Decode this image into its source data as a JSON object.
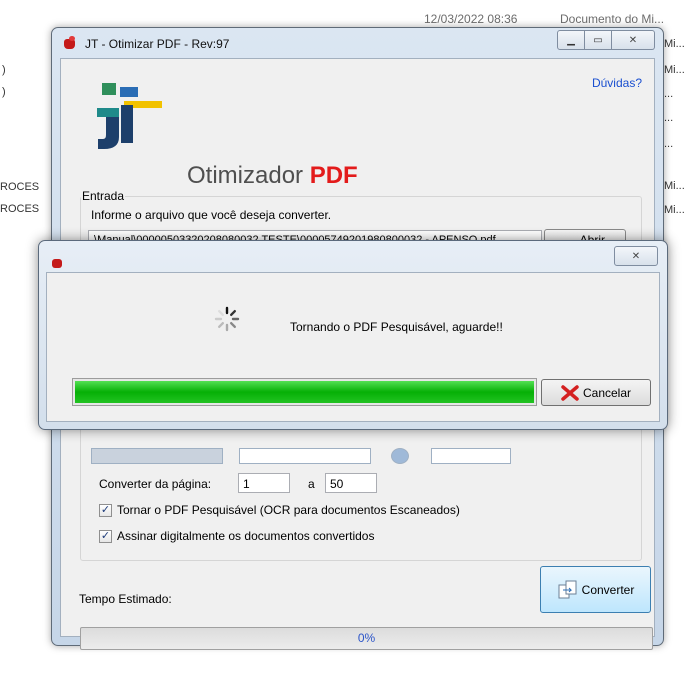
{
  "background": {
    "date": "12/03/2022 08:36",
    "doc": "Documento do Mi...",
    "right_cols": [
      "Mi...",
      "Mi...",
      "...",
      "...",
      "...",
      "Mi...",
      "Mi..."
    ],
    "left_items": [
      ")",
      ")",
      "ROCES",
      "ROCES"
    ]
  },
  "main_window": {
    "title": "JT - Otimizar PDF - Rev:97",
    "help_link": "Dúvidas?",
    "app_title_prefix": "Otimizador ",
    "app_title_suffix": "PDF",
    "entrada_label": "Entrada",
    "entrada_hint": "Informe o arquivo que você deseja converter.",
    "path_value": ".\\Manual\\00000503320208080032 TESTE\\00005749201980800032 - APENSO.pdf",
    "abrir_label": "Abrir",
    "converter_da_pagina_label": "Converter da página:",
    "page_from": "1",
    "a_label": "a",
    "page_to": "50",
    "checkbox_ocr_label": "Tornar o PDF Pesquisável (OCR para documentos Escaneados)",
    "checkbox_ocr_checked": true,
    "checkbox_sign_label": "Assinar digitalmente os documentos convertidos",
    "checkbox_sign_checked": true,
    "converter_label": "Converter",
    "tempo_label": "Tempo Estimado:",
    "progress_text": "0%",
    "progress_value": 0
  },
  "dialog": {
    "message": "Tornando o PDF Pesquisável, aguarde!!",
    "progress_value": 1.0,
    "cancel_label": "Cancelar"
  },
  "colors": {
    "pdf_red": "#e31b1b",
    "link_blue": "#1a4fd0",
    "progress_green": "#06b006"
  }
}
